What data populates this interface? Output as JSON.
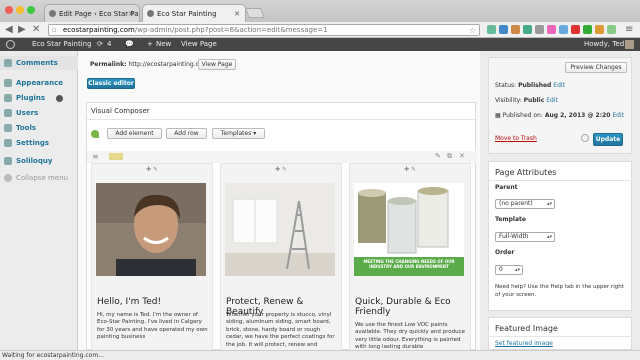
{
  "browser": {
    "tabs": [
      {
        "label": "Edit Page ‹ Eco Star Painting",
        "active": false
      },
      {
        "label": "Eco Star Painting",
        "active": true
      }
    ],
    "url_host": "ecostarpainting.com",
    "url_path": "/wp-admin/post.php?post=6&action=edit&message=1",
    "status_text": "Waiting for ecostarpainting.com..."
  },
  "adminbar": {
    "site_name": "Eco Star Painting",
    "updates_count": "4",
    "new_label": "New",
    "view_page_label": "View Page",
    "greeting": "Howdy, Ted"
  },
  "menu": {
    "items": [
      "Comments",
      "Appearance",
      "Plugins",
      "Users",
      "Tools",
      "Settings",
      "Soliloquy"
    ],
    "collapse_label": "Collapse menu"
  },
  "editor": {
    "permalink_label": "Permalink:",
    "permalink_url": "http://ecostarpainting.com/",
    "view_page_button": "View Page",
    "classic_editor_button": "Classic editor",
    "vc_title": "Visual Composer",
    "add_element": "Add element",
    "add_row": "Add row",
    "templates": "Templates",
    "cards": [
      {
        "title": "Hello, I'm Ted!",
        "body": "Hi, my name is Ted. I'm the owner of Eco-Star Painting. I've lived in Calgary for 30 years and have operated my own painting business"
      },
      {
        "title": "Protect, Renew & Beautify",
        "body": "Whether your property is stucco, vinyl siding, aluminum siding, smart board, brick, stone, hardy board or rough cedar, we have the perfect coatings for the job. It will protect, renew and"
      },
      {
        "title": "Quick, Durable & Eco Friendly",
        "body": "We use the finest Low VOC paints available. They dry quickly and produce very little odour. Everything is painted with long lasting durable"
      }
    ],
    "banner_text": "MEETING THE CHANGING NEEDS OF OUR INDUSTRY AND OUR ENVIRONMENT"
  },
  "publish": {
    "preview_button": "Preview Changes",
    "status_label": "Status:",
    "status_value": "Published",
    "visibility_label": "Visibility:",
    "visibility_value": "Public",
    "published_label": "Published on:",
    "published_value": "Aug 2, 2013 @ 2:20",
    "edit_label": "Edit",
    "trash_label": "Move to Trash",
    "update_button": "Update"
  },
  "page_attributes": {
    "title": "Page Attributes",
    "parent_label": "Parent",
    "parent_value": "(no parent)",
    "template_label": "Template",
    "template_value": "Full-Width",
    "order_label": "Order",
    "order_value": "0",
    "help_text_1": "Need help? Use the Help tab in the upper right",
    "help_text_2": "of your screen."
  },
  "featured_image": {
    "title": "Featured Image",
    "link": "Set featured image"
  },
  "colors": {
    "link": "#21759b",
    "adminbar": "#464646",
    "primary_button": "#21759b",
    "trash": "#bc0b0b"
  }
}
